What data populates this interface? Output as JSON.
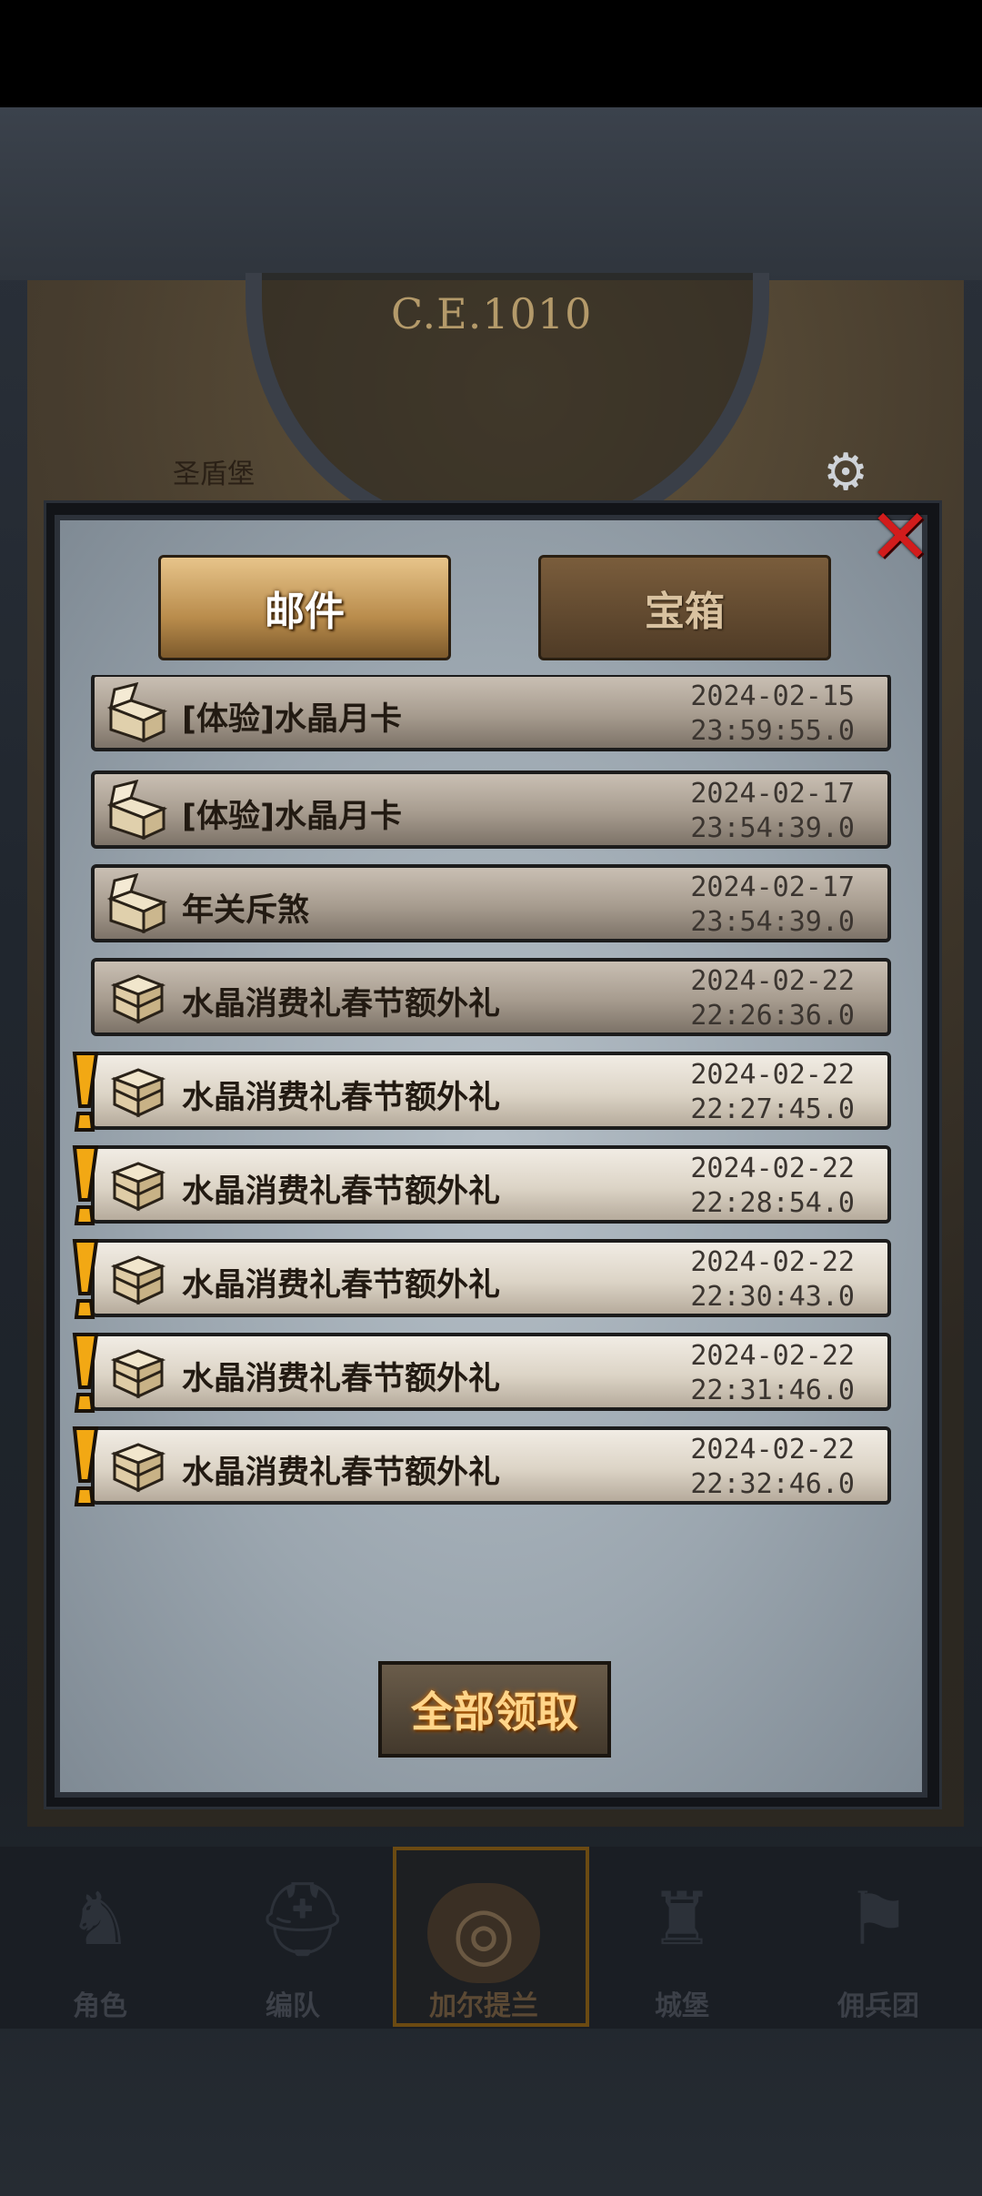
{
  "background": {
    "year_label": "C.E.1010",
    "shield_label": "圣盾堡"
  },
  "dialog": {
    "tabs": [
      {
        "label": "邮件",
        "active": true
      },
      {
        "label": "宝箱",
        "active": false
      }
    ],
    "mails": [
      {
        "title": "[体验]水晶月卡",
        "date": "2024-02-15",
        "time": "23:59:55.0",
        "read": true,
        "icon": "open-chest-icon"
      },
      {
        "title": "[体验]水晶月卡",
        "date": "2024-02-17",
        "time": "23:54:39.0",
        "read": true,
        "icon": "open-chest-icon"
      },
      {
        "title": "年关斥煞",
        "date": "2024-02-17",
        "time": "23:54:39.0",
        "read": true,
        "icon": "open-chest-icon"
      },
      {
        "title": "水晶消费礼春节额外礼",
        "date": "2024-02-22",
        "time": "22:26:36.0",
        "read": true,
        "icon": "closed-chest-icon"
      },
      {
        "title": "水晶消费礼春节额外礼",
        "date": "2024-02-22",
        "time": "22:27:45.0",
        "read": false,
        "icon": "closed-chest-icon"
      },
      {
        "title": "水晶消费礼春节额外礼",
        "date": "2024-02-22",
        "time": "22:28:54.0",
        "read": false,
        "icon": "closed-chest-icon"
      },
      {
        "title": "水晶消费礼春节额外礼",
        "date": "2024-02-22",
        "time": "22:30:43.0",
        "read": false,
        "icon": "closed-chest-icon"
      },
      {
        "title": "水晶消费礼春节额外礼",
        "date": "2024-02-22",
        "time": "22:31:46.0",
        "read": false,
        "icon": "closed-chest-icon"
      },
      {
        "title": "水晶消费礼春节额外礼",
        "date": "2024-02-22",
        "time": "22:32:46.0",
        "read": false,
        "icon": "closed-chest-icon"
      }
    ],
    "claim_all_label": "全部领取"
  },
  "nav": {
    "items": [
      {
        "label": "角色",
        "icon": "knight-icon"
      },
      {
        "label": "编队",
        "icon": "helmet-icon"
      },
      {
        "label": "加尔提兰",
        "icon": "world-medallion-icon"
      },
      {
        "label": "城堡",
        "icon": "castle-icon"
      },
      {
        "label": "佣兵团",
        "icon": "mercenary-icon"
      }
    ],
    "active_index": 2
  },
  "colors": {
    "alert": "#f2a814",
    "close": "#d21c1c",
    "active_tab": "#c9975a"
  }
}
